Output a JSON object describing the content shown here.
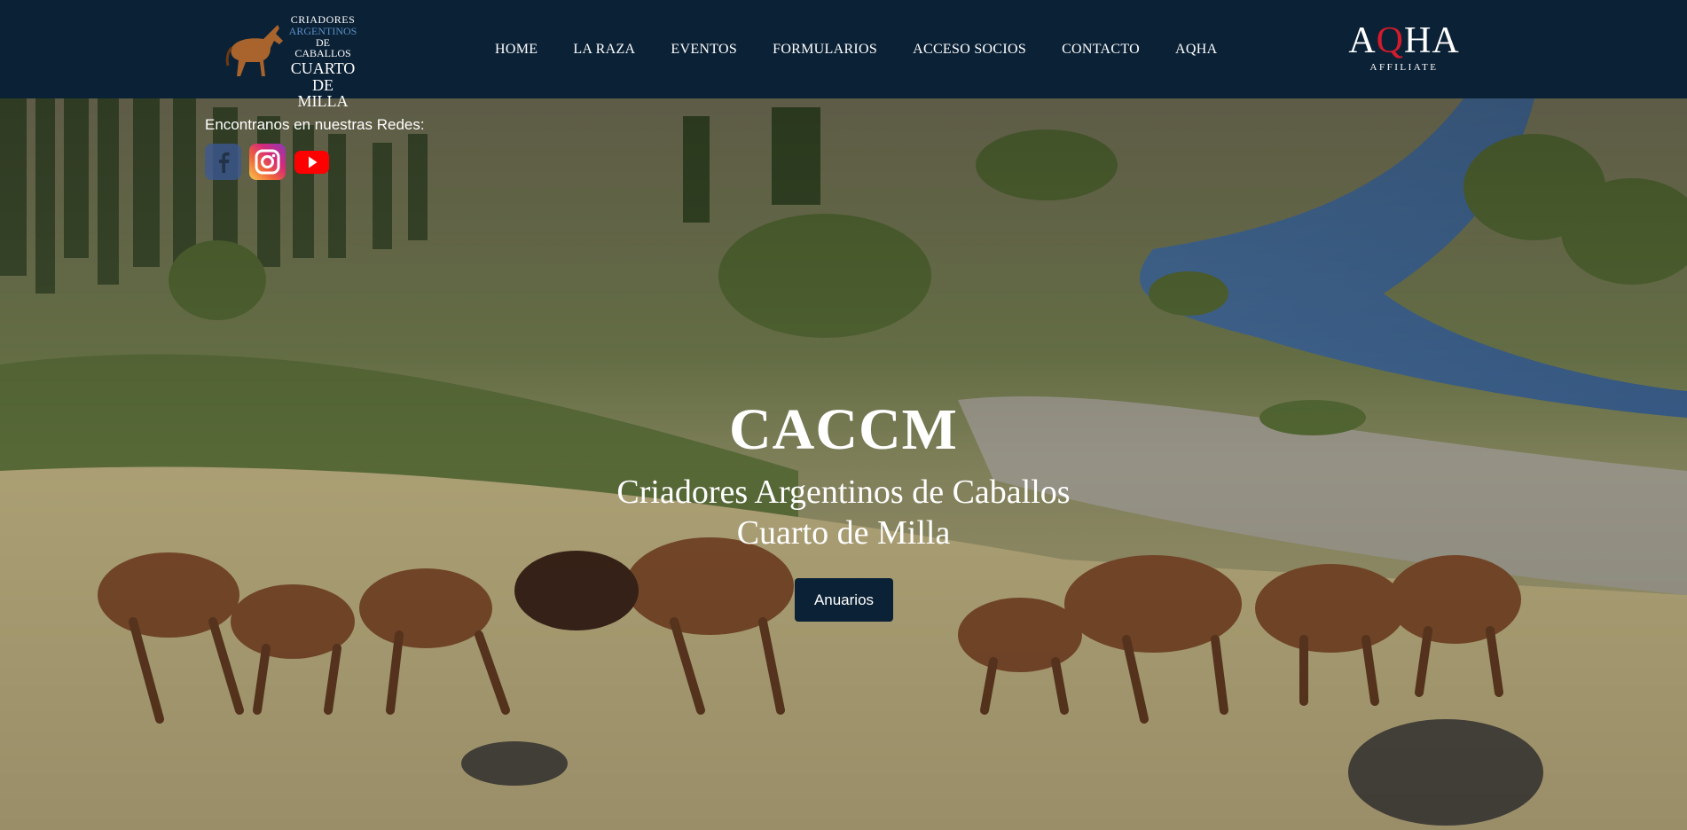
{
  "logo": {
    "line1": "CRIADORES",
    "line2": "ARGENTINOS",
    "line3": "DE CABALLOS",
    "line4": "CUARTO",
    "line5": "DE MILLA"
  },
  "nav": {
    "items": [
      {
        "label": "HOME"
      },
      {
        "label": "LA RAZA"
      },
      {
        "label": "EVENTOS"
      },
      {
        "label": "FORMULARIOS"
      },
      {
        "label": "ACCESO SOCIOS"
      },
      {
        "label": "CONTACTO"
      },
      {
        "label": "AQHA"
      }
    ]
  },
  "affiliate": {
    "mark_a": "A",
    "mark_q": "Q",
    "mark_ha": "HA",
    "sub": "AFFILIATE"
  },
  "social": {
    "label": "Encontranos en nuestras Redes:",
    "icons": [
      "facebook-icon",
      "instagram-icon",
      "youtube-icon"
    ]
  },
  "hero": {
    "title": "CACCM",
    "subtitle_line1": "Criadores Argentinos de Caballos",
    "subtitle_line2": "Cuarto de Milla",
    "button_label": "Anuarios"
  },
  "colors": {
    "header_bg": "#0b2136",
    "button_bg": "#0b2136",
    "accent_red": "#d31c2b",
    "accent_blue": "#5a8fc7"
  }
}
